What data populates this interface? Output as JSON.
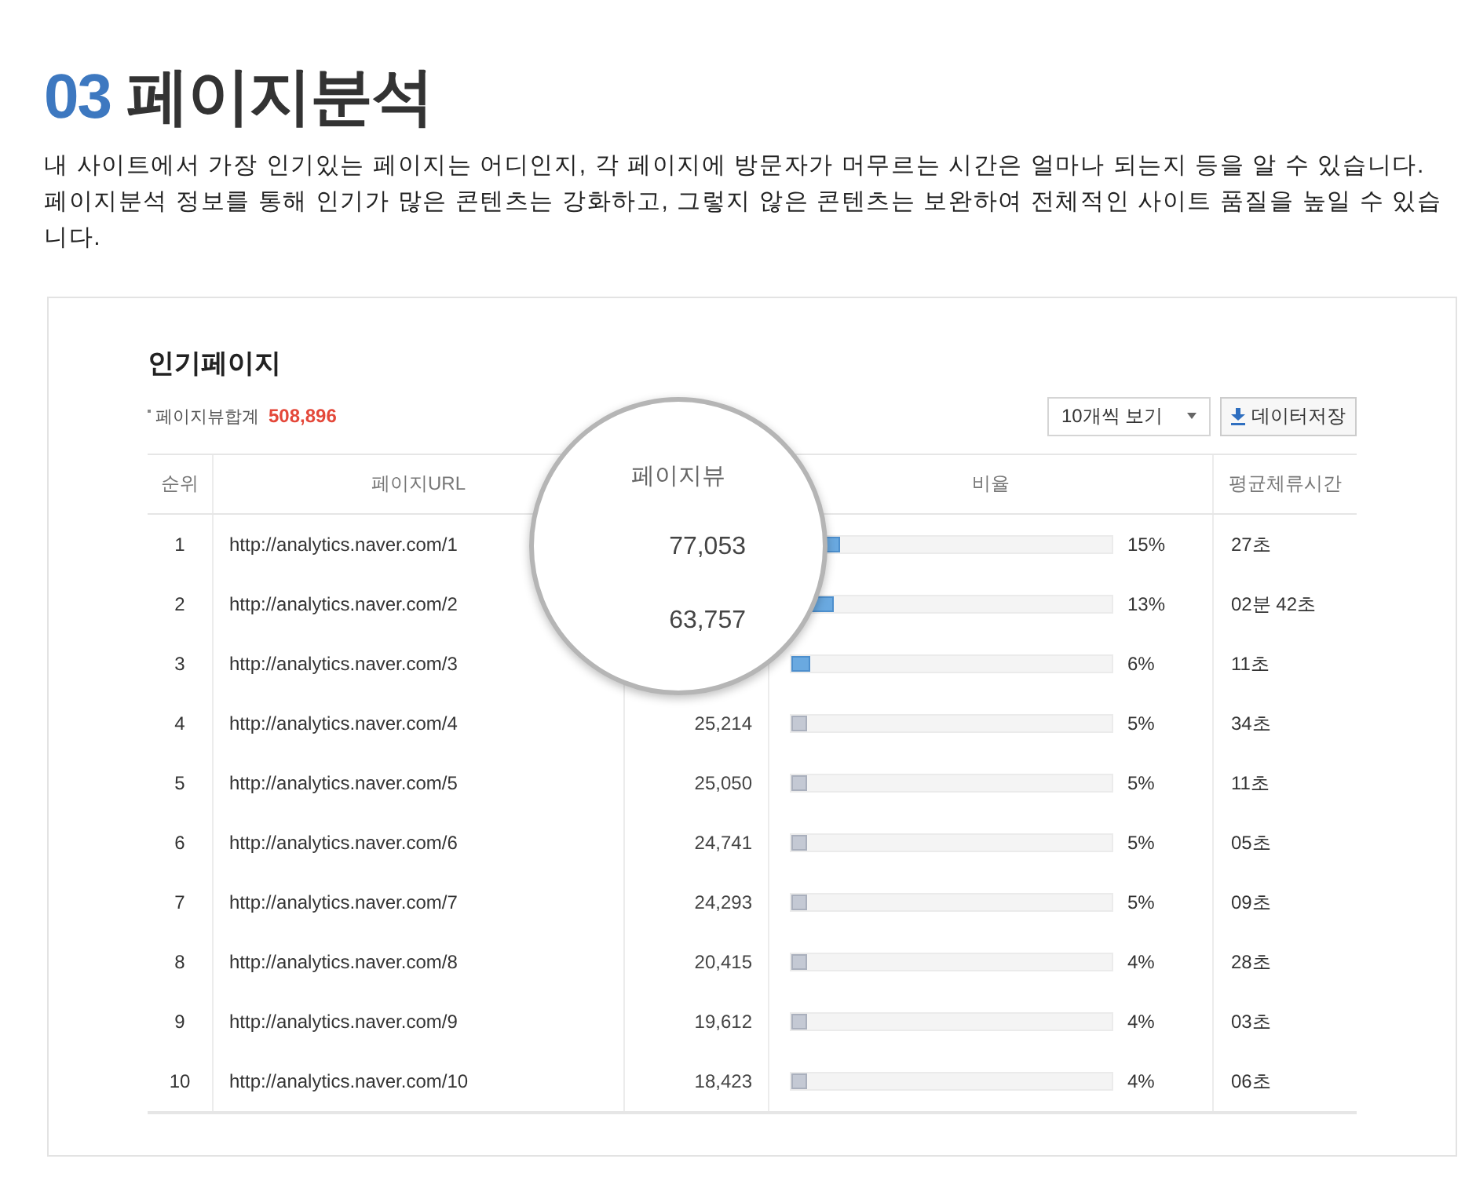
{
  "heading": {
    "number": "03",
    "title": "페이지분석"
  },
  "description": "내 사이트에서 가장 인기있는 페이지는 어디인지, 각 페이지에 방문자가 머무르는 시간은 얼마나 되는지 등을 알 수 있습니다. 페이지분석 정보를 통해 인기가 많은 콘텐츠는 강화하고, 그렇지 않은 콘텐츠는 보완하여 전체적인 사이트 품질을 높일 수 있습니다.",
  "panel": {
    "title": "인기페이지",
    "total_label": "페이지뷰합계",
    "total_value": "508,896",
    "page_size_select": "10개씩 보기",
    "save_button": "데이터저장"
  },
  "table": {
    "columns": [
      "순위",
      "페이지URL",
      "비율",
      "평균체류시간"
    ],
    "rows": [
      {
        "rank": "1",
        "url": "http://analytics.naver.com/1",
        "ratio": "15%",
        "level": 0.15,
        "highlighted": true,
        "time": "27초"
      },
      {
        "rank": "2",
        "url": "http://analytics.naver.com/2",
        "ratio": "13%",
        "level": 0.13,
        "highlighted": true,
        "time": "02분 42초"
      },
      {
        "rank": "3",
        "url": "http://analytics.naver.com/3",
        "ratio": "6%",
        "level": 0.06,
        "highlighted": true,
        "time": "11초"
      },
      {
        "rank": "4",
        "url": "http://analytics.naver.com/4",
        "pageviews": "25,214",
        "ratio": "5%",
        "level": 0.05,
        "highlighted": false,
        "time": "34초"
      },
      {
        "rank": "5",
        "url": "http://analytics.naver.com/5",
        "pageviews": "25,050",
        "ratio": "5%",
        "level": 0.05,
        "highlighted": false,
        "time": "11초"
      },
      {
        "rank": "6",
        "url": "http://analytics.naver.com/6",
        "pageviews": "24,741",
        "ratio": "5%",
        "level": 0.05,
        "highlighted": false,
        "time": "05초"
      },
      {
        "rank": "7",
        "url": "http://analytics.naver.com/7",
        "pageviews": "24,293",
        "ratio": "5%",
        "level": 0.05,
        "highlighted": false,
        "time": "09초"
      },
      {
        "rank": "8",
        "url": "http://analytics.naver.com/8",
        "pageviews": "20,415",
        "ratio": "4%",
        "level": 0.04,
        "highlighted": false,
        "time": "28초"
      },
      {
        "rank": "9",
        "url": "http://analytics.naver.com/9",
        "pageviews": "19,612",
        "ratio": "4%",
        "level": 0.04,
        "highlighted": false,
        "time": "03초"
      },
      {
        "rank": "10",
        "url": "http://analytics.naver.com/10",
        "pageviews": "18,423",
        "ratio": "4%",
        "level": 0.04,
        "highlighted": false,
        "time": "06초"
      }
    ]
  },
  "magnifier": {
    "header": "페이지뷰",
    "values": [
      "77,053",
      "63,757"
    ]
  }
}
